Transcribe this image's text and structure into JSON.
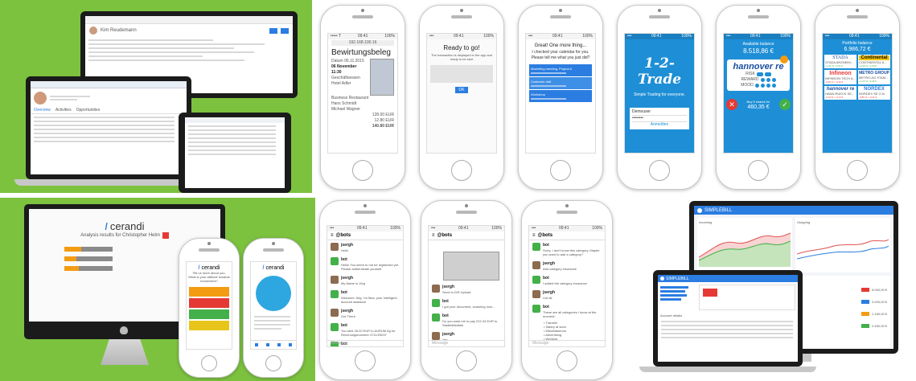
{
  "colors": {
    "background": "#7cc23f",
    "brand_blue": "#2b7de1",
    "trade_blue": "#1e8fd6",
    "orange": "#f39c12",
    "red": "#e53935",
    "green": "#43b049"
  },
  "laptop_crm": {
    "header_tabs": [
      "Overview",
      "Activities",
      "Opportunities"
    ],
    "person_name": "Kim Reudemann"
  },
  "phone_receipt": {
    "status_left": "••••• T",
    "status_time": "09:41",
    "status_right": "100%",
    "url": "192.168.100.16",
    "title": "Bewirtungsbeleg",
    "lines": [
      "Datum 06.11.2015",
      "06 November",
      "11:30",
      "Geschäftsessen",
      "Hotel Adler",
      "Business Restaurant",
      "Hans Schmidt",
      "Michael Wagner"
    ],
    "amounts": [
      "128.00 EUR",
      "12.80 EUR",
      "140.80 EUR"
    ]
  },
  "phone_ready": {
    "title": "Ready to go!",
    "body": "The transaction is displayed in the app and ready to be sent",
    "button": "OK"
  },
  "phone_great": {
    "title": "Great! One more thing...",
    "body": "I checked your calendar for you. Please tell me what you just did?",
    "options": [
      "Marketing meeting, Project A",
      "Customer visit",
      "Workshop"
    ]
  },
  "phone_trade": {
    "logo": "1-2-Trade",
    "tagline": "Simple Trading for everyone.",
    "username": "Demouser",
    "password": "••••••••",
    "button": "Anmelden"
  },
  "phone_hannover": {
    "label": "Available balance",
    "balance": "8.518,86 €",
    "company": "hannover re",
    "rows": [
      "RISK",
      "REWARD",
      "MOOD"
    ],
    "buy_label": "Buy 5 shares for",
    "buy_price": "460,35 €"
  },
  "phone_portfolio": {
    "label": "Portfolio balance",
    "balance": "6.986,72 €",
    "stocks": [
      {
        "name": "STADA",
        "sub": "STADA ARZNEIM...",
        "delta": "+1,01 % / 0,57 €"
      },
      {
        "name": "Continental",
        "sub": "CONTINENTAL A...",
        "delta": "+2,09 % / 3,20 €"
      },
      {
        "name": "Infineon",
        "sub": "INFINEON TECH A...",
        "delta": "-0,66 % / -0,16 €"
      },
      {
        "name": "METRO GROUP",
        "sub": "METRO AG STAM...",
        "delta": "+1,23 % / 0,35 €"
      },
      {
        "name": "hannover re",
        "sub": "HANN.RUECK SE...",
        "delta": "-0,16 % / -0,14 €"
      },
      {
        "name": "NORDEX",
        "sub": "NORDEX SE O.N.",
        "delta": "-0,85 % / -0,21 €"
      }
    ]
  },
  "imac_cerandi": {
    "logo": "cerandi",
    "subtitle": "Analysis results for Christopher Helm",
    "bars": [
      0.35,
      0.25,
      0.3
    ]
  },
  "phone_cerandi_1": {
    "logo": "cerandi",
    "lines": [
      "Tell us more about you.",
      "What is your attitude towards investment?"
    ],
    "option_colors": [
      "#f39c12",
      "#e53935",
      "#43b049",
      "#e8c51a"
    ]
  },
  "phone_cerandi_2": {
    "logo": "cerandi"
  },
  "phone_slack_1": {
    "channel": "@bots",
    "messages": [
      {
        "user": "jsergh",
        "text": "Hello"
      },
      {
        "user": "bot",
        "text": "Hello! You seem to not be registered yet. Please authenticate yourself"
      },
      {
        "user": "jsergh",
        "text": "My Name is Jörg"
      },
      {
        "user": "bot",
        "text": "Welcome Jörg, I'm Max, your intelligent account assistant"
      },
      {
        "user": "jsergh",
        "text": "Got There"
      },
      {
        "user": "bot",
        "text": "You sent 28.20 EUR to AURUM Ag for Rechnungsnummer 4711/20037"
      },
      {
        "user": "bot",
        "text": "You sent 230.00 EUR to Techniker Krankenkasse for Beiträge"
      }
    ],
    "input": "Message"
  },
  "phone_slack_2": {
    "channel": "@bots",
    "messages": [
      {
        "user": "jsergh",
        "text": "Send to DIS Upload"
      },
      {
        "user": "bot",
        "text": "I got your document, scanning now..."
      },
      {
        "user": "bot",
        "text": "Do you want me to pay 222.34 EUR to Stadtbibliothek"
      },
      {
        "user": "jsergh",
        "text": "Yes"
      },
      {
        "user": "bot",
        "text": "You should receive an SMS TAN now - please enter the TAN to finish"
      }
    ],
    "input": "Message"
  },
  "phone_slack_3": {
    "channel": "@bots",
    "messages": [
      {
        "user": "bot",
        "text": "Sorry, I don't know this category. Maybe you want to add a category?"
      },
      {
        "user": "jsergh",
        "text": "Add category insurance"
      },
      {
        "user": "bot",
        "text": "I added the category insurance"
      },
      {
        "user": "jsergh",
        "text": "List all"
      },
      {
        "user": "bot",
        "text": "These are all categories I know at the moment:"
      }
    ],
    "categories": [
      "Transfer",
      "Salary at work",
      "Miscellaneous",
      "Advertising",
      "Working",
      "Entertainment",
      "Sports",
      "Direct debit",
      "Standing order",
      "Insurance"
    ],
    "input": "Message"
  },
  "dashboard_simple": {
    "brand": "SIMPLEBILL",
    "chart_titles": [
      "Incoming",
      "Outgoing"
    ],
    "amounts": [
      "5.000,00 €",
      "3.200,00 €",
      "1.150,00 €",
      "2.450,00 €"
    ]
  },
  "laptop_simple": {
    "brand": "SIMPLEBILL",
    "section": "Account details"
  }
}
